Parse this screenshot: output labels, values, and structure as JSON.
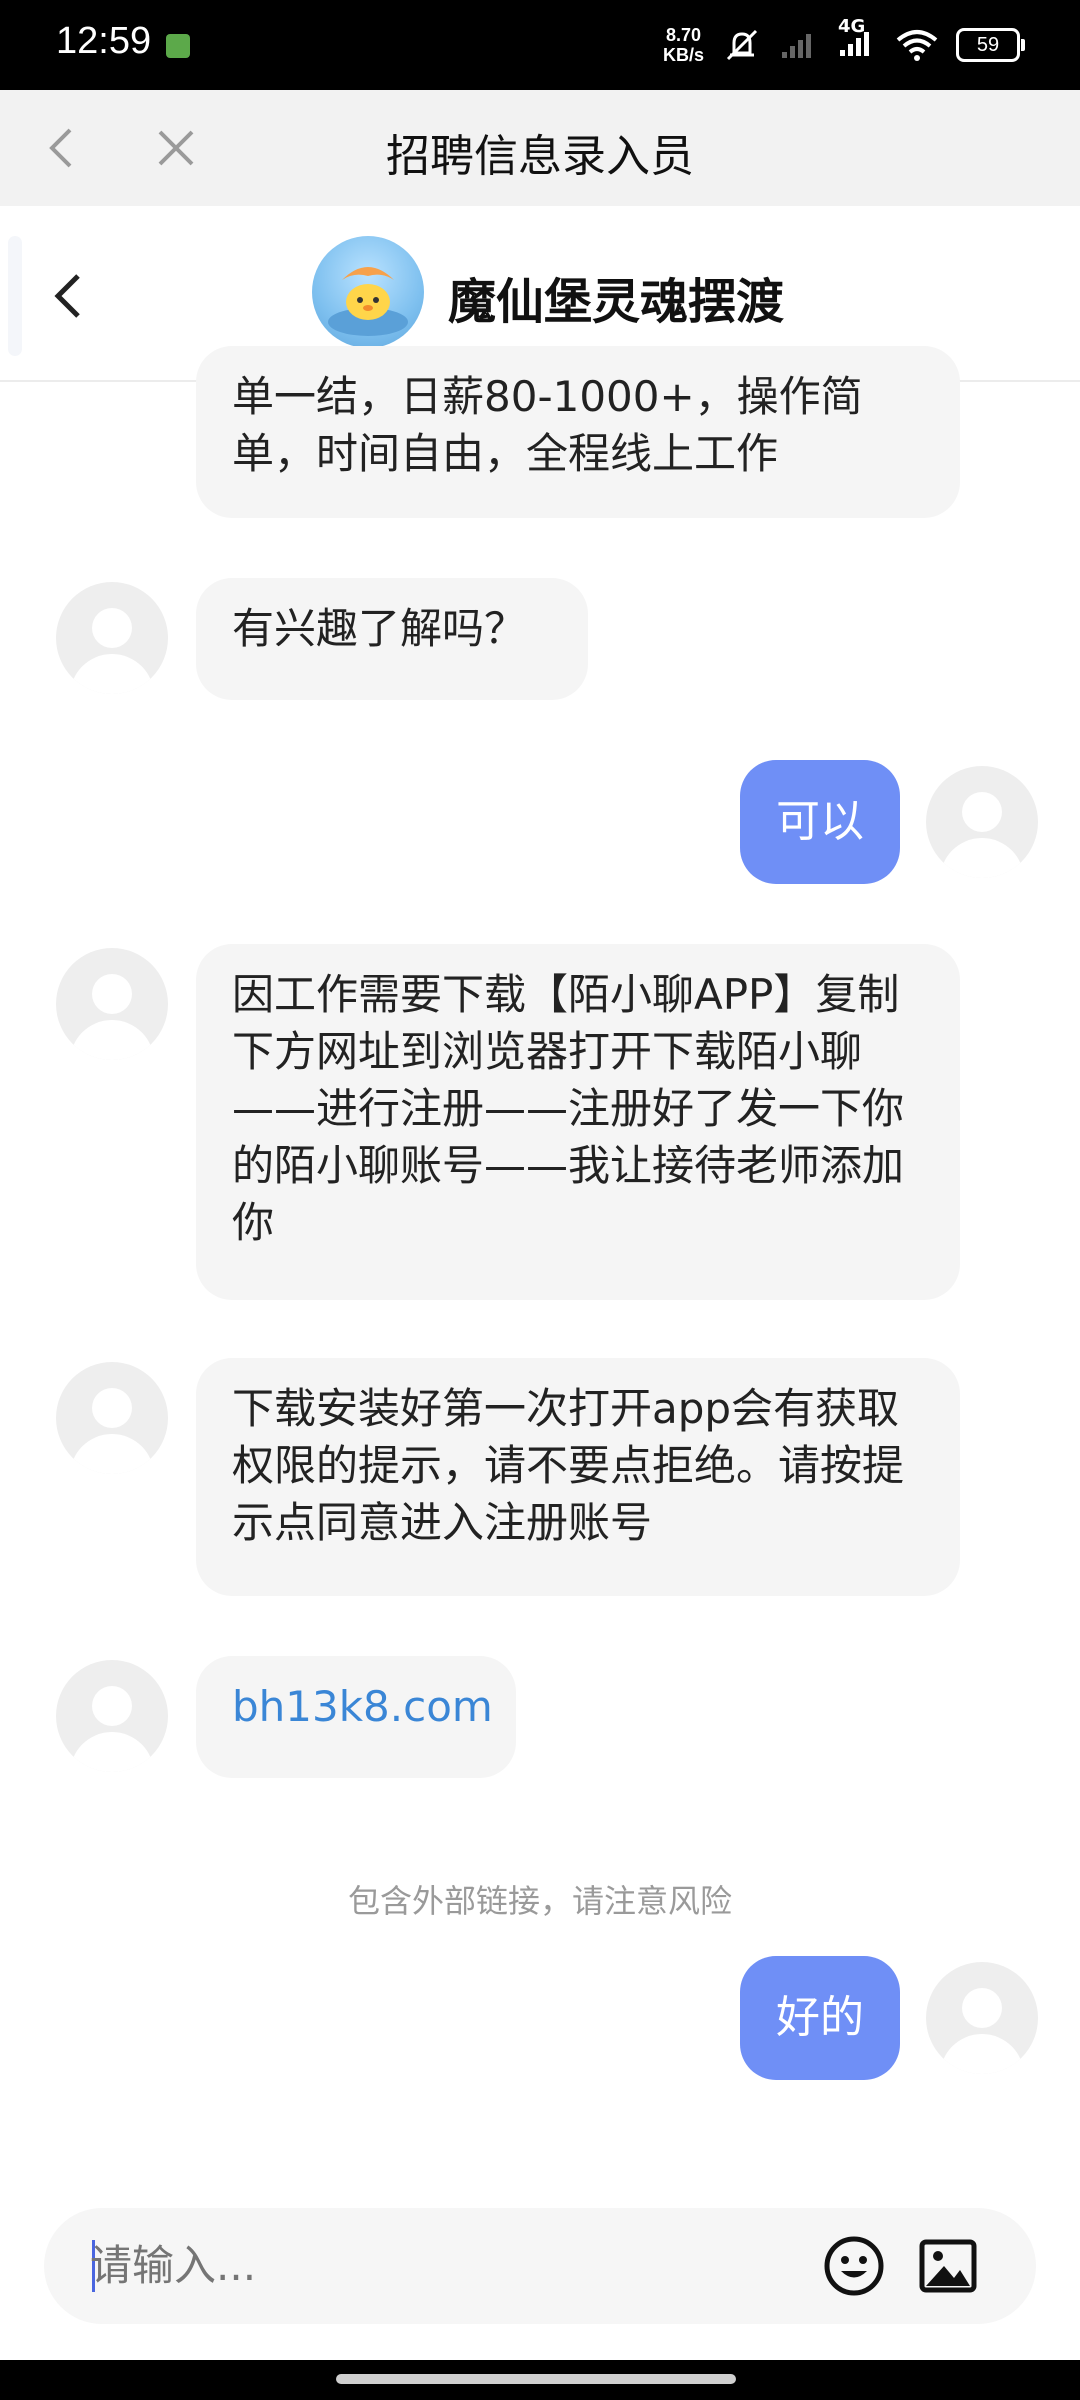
{
  "status_bar": {
    "time": "12:59",
    "speed_value": "8.70",
    "speed_unit": "KB/s",
    "network": "4G",
    "battery": "59"
  },
  "web_bar": {
    "title": "招聘信息录入员"
  },
  "chat_header": {
    "name": "魔仙堡灵魂摆渡"
  },
  "messages": [
    {
      "from": "other",
      "text": "单一结，日薪80-1000+，操作简单，时间自由，全程线上工作"
    },
    {
      "from": "other",
      "text": "有兴趣了解吗？"
    },
    {
      "from": "me",
      "text": "可以"
    },
    {
      "from": "other",
      "text": "因工作需要下载【陌小聊APP】复制下方网址到浏览器打开下载陌小聊——进行注册——注册好了发一下你的陌小聊账号——我让接待老师添加你"
    },
    {
      "from": "other",
      "text": "下载安装好第一次打开app会有获取权限的提示，请不要点拒绝。请按提示点同意进入注册账号"
    },
    {
      "from": "other",
      "text": "bh13k8.com"
    },
    {
      "from": "system",
      "text": "包含外部链接，请注意风险"
    },
    {
      "from": "me",
      "text": "好的"
    }
  ],
  "input": {
    "placeholder": "请输入..."
  },
  "colors": {
    "accent_bubble": "#6f8ff6",
    "link": "#3a86d6"
  }
}
